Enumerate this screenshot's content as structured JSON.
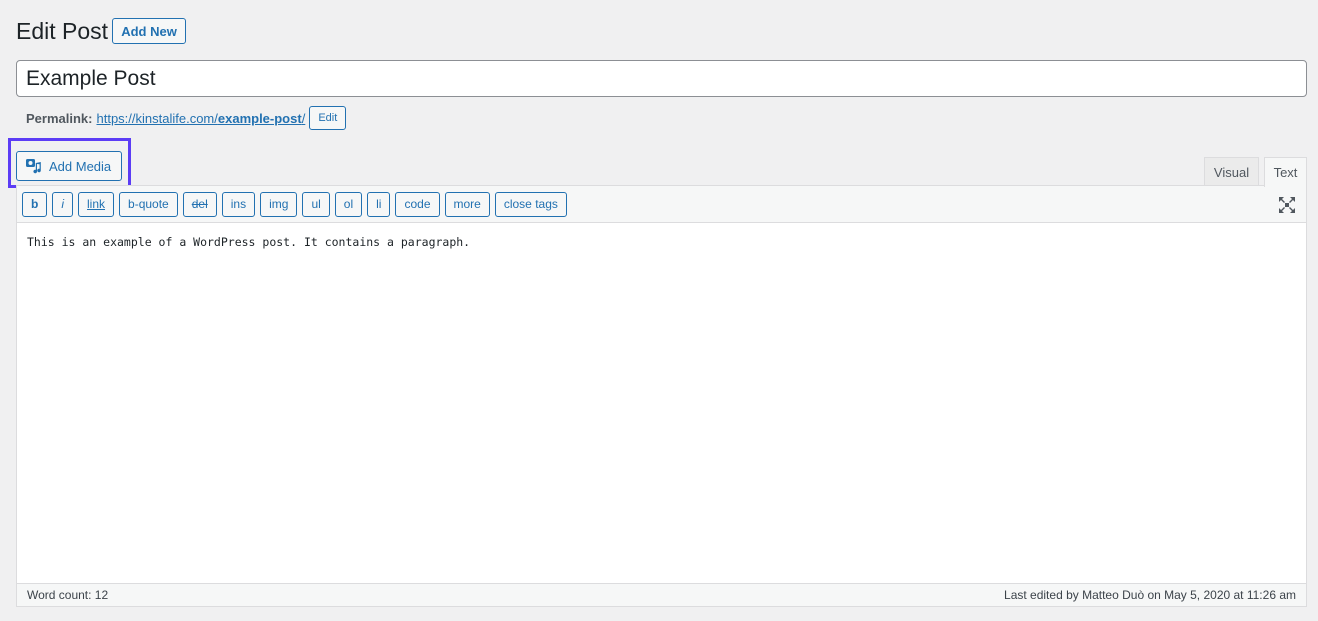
{
  "header": {
    "title": "Edit Post",
    "add_new_label": "Add New"
  },
  "post": {
    "title": "Example Post"
  },
  "permalink": {
    "label": "Permalink:",
    "url_base": "https://kinstalife.com/",
    "slug": "example-post",
    "trailing": "/",
    "edit_label": "Edit"
  },
  "media": {
    "add_media_label": "Add Media",
    "highlight_color": "#5b3cf5"
  },
  "tabs": [
    {
      "label": "Visual",
      "active": false
    },
    {
      "label": "Text",
      "active": true
    }
  ],
  "toolbar": {
    "buttons": [
      "b",
      "i",
      "link",
      "b-quote",
      "del",
      "ins",
      "img",
      "ul",
      "ol",
      "li",
      "code",
      "more",
      "close tags"
    ],
    "fullscreen_icon": "fullscreen-icon"
  },
  "editor": {
    "content": "This is an example of a WordPress post. It contains a paragraph."
  },
  "footer": {
    "word_count": "Word count: 12",
    "last_edited": "Last edited by Matteo Duò on May 5, 2020 at 11:26 am"
  },
  "colors": {
    "accent": "#2271b1",
    "background": "#f0f0f1"
  }
}
